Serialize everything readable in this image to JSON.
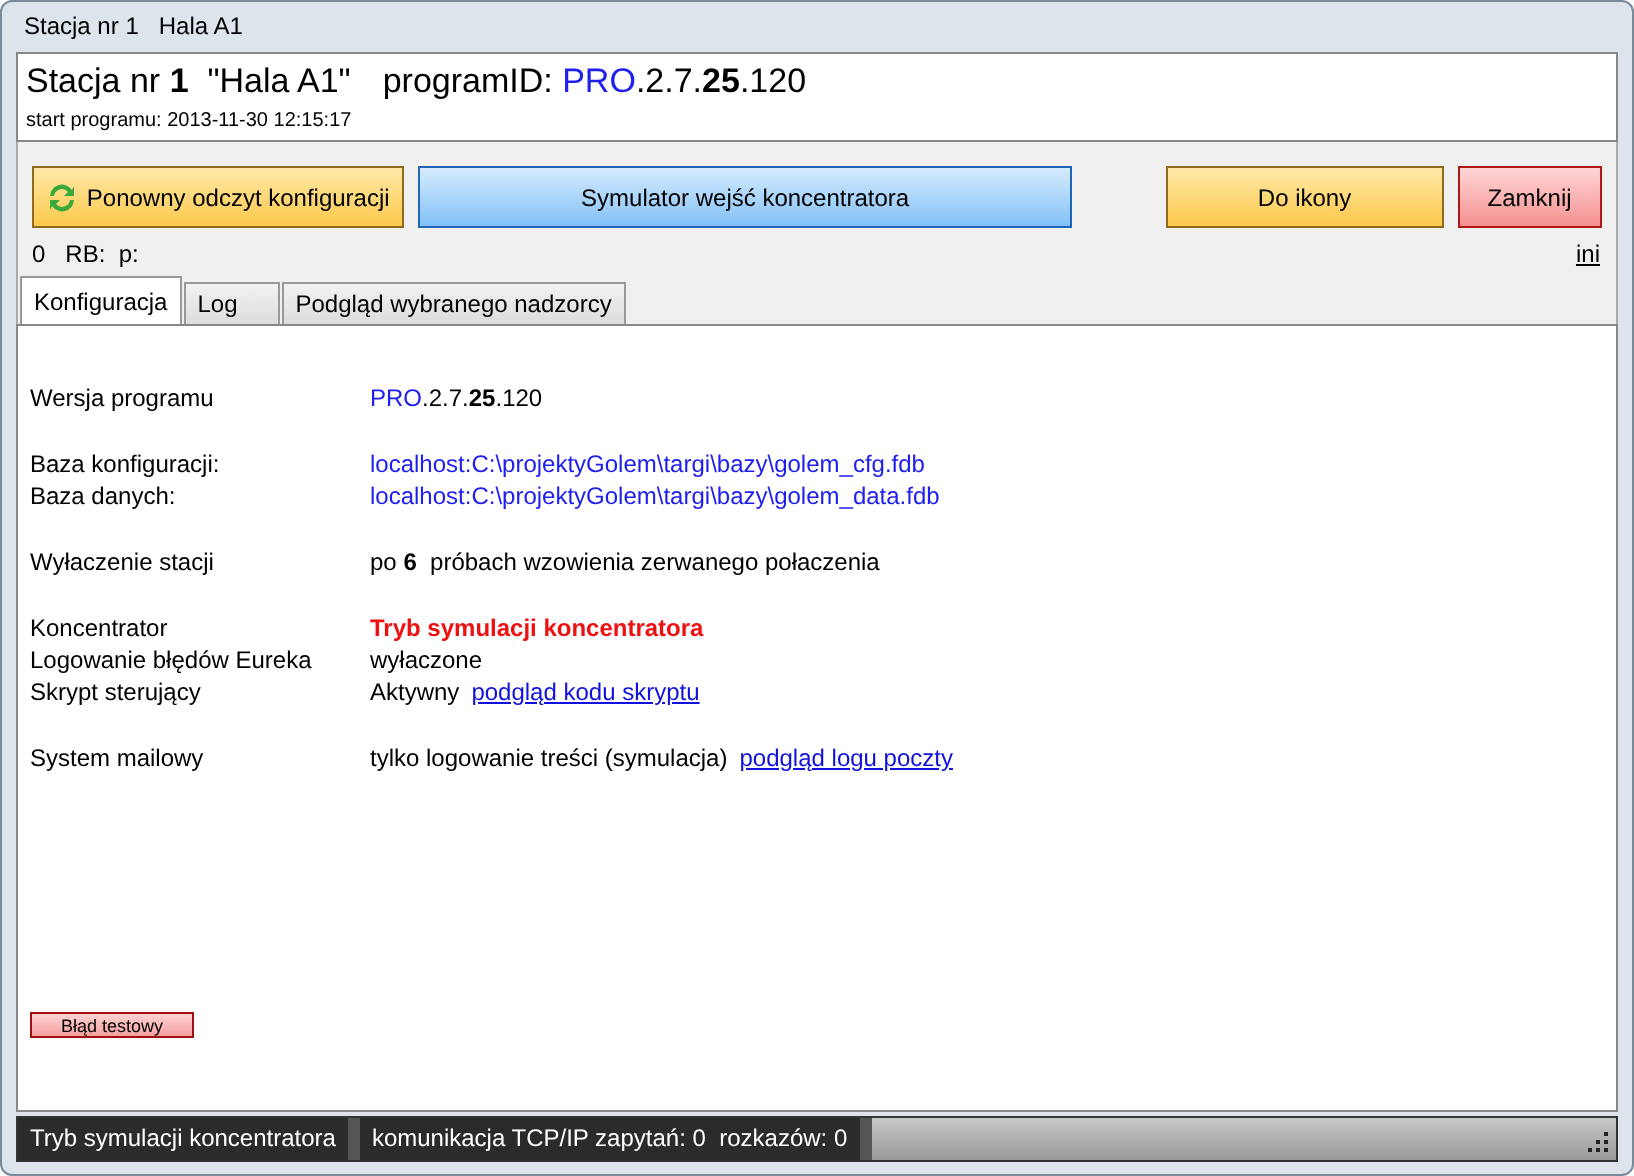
{
  "window": {
    "title": "Stacja nr 1   Hala A1"
  },
  "header": {
    "station": "Stacja nr **1**  \"Hala A1\"",
    "program_id": [
      {
        "kind": "plain",
        "text": "programID: "
      },
      {
        "kind": "accent",
        "text": "PRO"
      },
      {
        "kind": "plain",
        "text": ".2.7.**25**.120"
      }
    ],
    "start": "start programu: 2013-11-30 12:15:17"
  },
  "toolbar": [
    {
      "label": "Ponowny odczyt konfiguracji",
      "kind": "reload"
    },
    {
      "label": "Symulator wejść koncentratora",
      "kind": "blue"
    },
    {
      "label": "Do ikony",
      "kind": "orange"
    },
    {
      "label": "Zamknij",
      "kind": "red"
    }
  ],
  "status_line": {
    "text": "0   RB:  p:",
    "link": "ini"
  },
  "tabs": [
    {
      "label": "Konfiguracja",
      "selected": true
    },
    {
      "label": "Log",
      "selected": false
    },
    {
      "label": "Podgląd wybranego nadzorcy",
      "selected": false
    }
  ],
  "groups": [
    [
      {
        "label": "Wersja programu",
        "value": [
          {
            "kind": "accent",
            "text": "PRO"
          },
          {
            "kind": "plain",
            "text": ".2.7.**25**.120"
          }
        ]
      }
    ],
    [
      {
        "label": "Baza konfiguracji:",
        "value": [
          {
            "kind": "accent",
            "text": "localhost:C:\\projektyGolem\\targi\\bazy\\golem_cfg.fdb"
          }
        ]
      },
      {
        "label": "Baza danych:",
        "value": [
          {
            "kind": "accent",
            "text": "localhost:C:\\projektyGolem\\targi\\bazy\\golem_data.fdb"
          }
        ]
      }
    ],
    [
      {
        "label": "Wyłaczenie stacji",
        "value": [
          {
            "kind": "plain",
            "text": "po **6**  próbach wzowienia zerwanego połaczenia"
          }
        ]
      }
    ],
    [
      {
        "label": "Koncentrator",
        "value": [
          {
            "kind": "alert",
            "text": "Tryb symulacji koncentratora"
          }
        ]
      },
      {
        "label": "Logowanie błędów Eureka",
        "value": [
          {
            "kind": "plain",
            "text": "wyłaczone"
          }
        ]
      },
      {
        "label": "Skrypt sterujący",
        "value": [
          {
            "kind": "plain",
            "text": "Aktywny"
          }
        ],
        "link": "podgląd kodu skryptu"
      }
    ],
    [
      {
        "label": "System mailowy",
        "value": [
          {
            "kind": "plain",
            "text": "tylko logowanie treści (symulacja)"
          }
        ],
        "link": "podgląd logu poczty"
      }
    ]
  ],
  "test_button": "Błąd testowy",
  "status_bar": [
    "Tryb symulacji koncentratora",
    "komunikacja TCP/IP zapytań: 0  rozkazów: 0"
  ]
}
